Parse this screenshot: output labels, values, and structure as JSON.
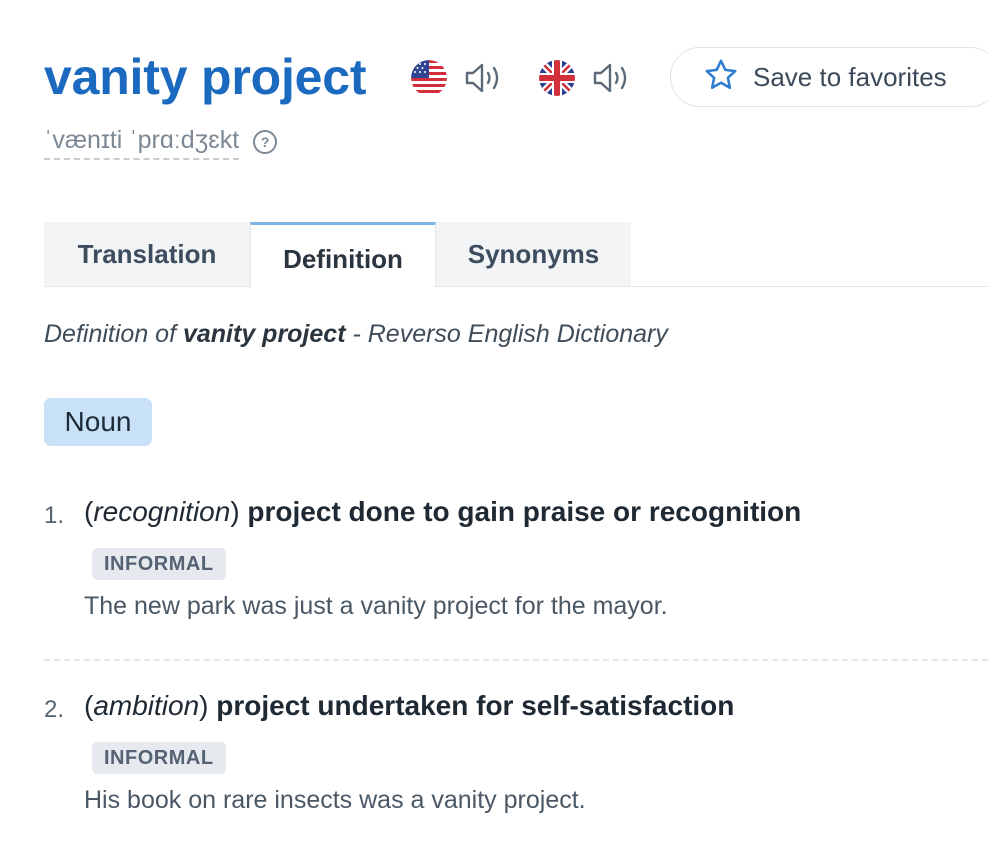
{
  "header": {
    "headword": "vanity project",
    "phonetic": "ˈvænɪti ˈprɑːdʒɛkt",
    "help_symbol": "?",
    "favorites_label": "Save to favorites",
    "audio": [
      {
        "accent": "US",
        "flag_icon": "us-flag-icon",
        "speaker_icon": "speaker-icon"
      },
      {
        "accent": "UK",
        "flag_icon": "uk-flag-icon",
        "speaker_icon": "speaker-icon"
      }
    ]
  },
  "tabs": [
    {
      "label": "Translation",
      "active": false
    },
    {
      "label": "Definition",
      "active": true
    },
    {
      "label": "Synonyms",
      "active": false
    }
  ],
  "dictionary_title": {
    "prefix": "Definition of ",
    "term": "vanity project",
    "suffix": " - Reverso English Dictionary"
  },
  "part_of_speech": "Noun",
  "definitions": [
    {
      "number": "1.",
      "context": "recognition",
      "gloss": "project done to gain praise or recognition",
      "register": "INFORMAL",
      "example": "The new park was just a vanity project for the mayor."
    },
    {
      "number": "2.",
      "context": "ambition",
      "gloss": "project undertaken for self-satisfaction",
      "register": "INFORMAL",
      "example": "His book on rare insects was a vanity project."
    }
  ],
  "colors": {
    "headword": "#1b6ac0",
    "star": "#2f7dd1",
    "pos_badge": "#c8e1f7",
    "active_tab_accent": "#7ab5e6"
  }
}
